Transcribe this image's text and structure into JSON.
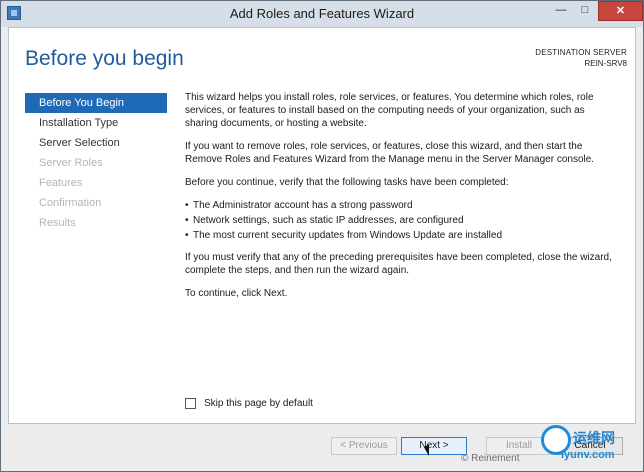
{
  "window": {
    "title": "Add Roles and Features Wizard",
    "minimize": "—",
    "maximize": "□",
    "close": "✕"
  },
  "header": {
    "page_title": "Before you begin",
    "destination_label": "DESTINATION SERVER",
    "destination_server": "REIN-SRV8"
  },
  "sidebar": {
    "items": [
      {
        "label": "Before You Begin",
        "state": "active"
      },
      {
        "label": "Installation Type",
        "state": "enabled"
      },
      {
        "label": "Server Selection",
        "state": "enabled"
      },
      {
        "label": "Server Roles",
        "state": "disabled"
      },
      {
        "label": "Features",
        "state": "disabled"
      },
      {
        "label": "Confirmation",
        "state": "disabled"
      },
      {
        "label": "Results",
        "state": "disabled"
      }
    ]
  },
  "main": {
    "para1": "This wizard helps you install roles, role services, or features. You determine which roles, role services, or features to install based on the computing needs of your organization, such as sharing documents, or hosting a website.",
    "para2": "If you want to remove roles, role services, or features, close this wizard, and then start the Remove Roles and Features Wizard from the Manage menu in the Server Manager console.",
    "para3": "Before you continue, verify that the following tasks have been completed:",
    "bullets": [
      "The Administrator account has a strong password",
      "Network settings, such as static IP addresses, are configured",
      "The most current security updates from Windows Update are installed"
    ],
    "para4": "If you must verify that any of the preceding prerequisites have been completed, close the wizard, complete the steps, and then run the wizard again.",
    "para5": "To continue, click Next."
  },
  "skip": {
    "label": "Skip this page by default",
    "checked": false
  },
  "footer": {
    "previous": "< Previous",
    "next": "Next >",
    "install": "Install",
    "cancel": "Cancel"
  },
  "watermark": {
    "credit": "© Reinement",
    "logo_text": "运维网",
    "logo_sub": "iyunv.com"
  },
  "colors": {
    "accent": "#1e6ab7",
    "title_blue": "#1f5d9a",
    "close_red": "#c7463d"
  }
}
